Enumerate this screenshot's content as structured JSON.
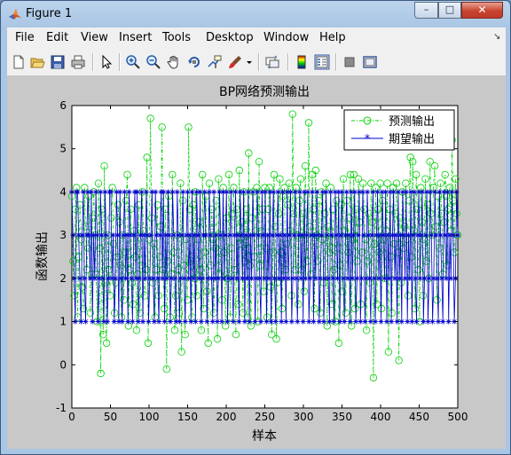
{
  "window": {
    "title": "Figure 1",
    "minimize": "–",
    "maximize": "□",
    "close": "✕"
  },
  "menubar": {
    "items": [
      "File",
      "Edit",
      "View",
      "Insert",
      "Tools",
      "Desktop",
      "Window",
      "Help"
    ],
    "overflow": "↘"
  },
  "toolbar": {
    "buttons": [
      "new-figure",
      "open-file",
      "save-figure",
      "print-figure",
      "edit-plot",
      "zoom-in",
      "zoom-out",
      "pan",
      "rotate-3d",
      "data-cursor",
      "brush",
      "brush-dropdown",
      "link-plot",
      "insert-colorbar",
      "insert-legend",
      "hide-plot-tools",
      "show-plot-tools"
    ]
  },
  "chart_data": {
    "type": "line",
    "title": "BP网络预测输出",
    "xlabel": "样本",
    "ylabel": "函数输出",
    "xlim": [
      0,
      500
    ],
    "ylim": [
      -1,
      6
    ],
    "xticks": [
      "0",
      "50",
      "100",
      "150",
      "200",
      "250",
      "300",
      "350",
      "400",
      "450",
      "500"
    ],
    "yticks": [
      "-1",
      "0",
      "1",
      "2",
      "3",
      "4",
      "5",
      "6"
    ],
    "grid": false,
    "legend_position": "top-right",
    "series": [
      {
        "name": "预测输出",
        "color": "#00d000",
        "marker": "o",
        "linestyle": "dash-dot",
        "values": [
          3.9,
          2.4,
          1.6,
          3.6,
          4.1,
          1.1,
          2.5,
          3.7,
          2.9,
          1.8,
          1.3,
          4.1,
          3.2,
          2.2,
          2.7,
          3.9,
          1.2,
          2.1,
          3.4,
          4.0,
          3.0,
          2.1,
          1.0,
          4.2,
          2.7,
          -0.2,
          3.6,
          0.7,
          4.6,
          1.9,
          0.5,
          3.0,
          2.2,
          1.6,
          3.4,
          4.1,
          2.8,
          1.2,
          1.9,
          2.5,
          3.7,
          3.3,
          2.3,
          1.1,
          3.0,
          1.5,
          2.6,
          3.8,
          4.4,
          0.9,
          2.2,
          3.6,
          1.9,
          1.4,
          3.1,
          2.5,
          0.8,
          2.1,
          3.7,
          1.2,
          2.3,
          4.0,
          3.1,
          1.6,
          2.2,
          4.8,
          0.5,
          2.9,
          5.7,
          3.4,
          1.9,
          2.8,
          1.1,
          2.2,
          3.7,
          1.6,
          2.5,
          3.2,
          5.5,
          2.2,
          1.3,
          3.6,
          -0.1,
          2.4,
          3.9,
          1.1,
          2.1,
          4.4,
          2.6,
          0.8,
          1.6,
          3.0,
          2.2,
          1.2,
          4.2,
          0.3,
          3.8,
          2.3,
          0.7,
          2.9,
          1.5,
          5.5,
          3.6,
          2.4,
          1.1,
          3.7,
          2.0,
          4.0,
          1.6,
          2.9,
          3.3,
          2.2,
          0.8,
          4.4,
          1.3,
          2.6,
          3.9,
          1.7,
          0.5,
          4.2,
          2.3,
          3.6,
          2.9,
          1.2,
          2.7,
          3.8,
          0.6,
          4.3,
          2.1,
          3.0,
          1.5,
          4.1,
          2.6,
          0.9,
          3.4,
          2.0,
          4.4,
          1.1,
          2.7,
          3.5,
          4.1,
          2.2,
          0.7,
          3.6,
          1.4,
          4.5,
          2.8,
          3.3,
          1.2,
          4.0,
          2.4,
          3.6,
          1.1,
          4.9,
          2.3,
          0.9,
          3.4,
          4.0,
          2.5,
          3.1,
          4.1,
          1.0,
          4.7,
          2.3,
          3.1,
          3.6,
          1.7,
          4.1,
          2.7,
          1.1,
          3.6,
          4.1,
          1.8,
          0.7,
          2.6,
          4.4,
          3.2,
          0.6,
          1.9,
          3.5,
          4.3,
          2.6,
          1.3,
          3.9,
          4.1,
          2.2,
          2.8,
          3.7,
          4.2,
          3.1,
          1.6,
          5.8,
          3.5,
          2.2,
          4.1,
          3.0,
          1.4,
          3.8,
          4.3,
          2.2,
          3.5,
          1.7,
          4.6,
          3.0,
          2.4,
          5.6,
          3.2,
          2.1,
          4.4,
          3.6,
          1.3,
          4.5,
          3.0,
          2.4,
          3.8,
          1.2,
          4.0,
          2.9,
          1.9,
          3.5,
          4.2,
          0.9,
          3.2,
          2.6,
          4.1,
          1.4,
          3.6,
          2.2,
          1.0,
          3.8,
          2.7,
          0.5,
          2.3,
          3.7,
          1.7,
          4.3,
          3.1,
          1.2,
          3.8,
          2.6,
          3.4,
          4.4,
          0.9,
          2.9,
          4.4,
          1.3,
          3.6,
          2.4,
          4.3,
          3.3,
          1.4,
          2.6,
          4.2,
          3.6,
          2.9,
          0.8,
          2.4,
          3.5,
          1.9,
          4.2,
          3.3,
          -0.3,
          2.8,
          4.1,
          1.4,
          3.6,
          2.6,
          4.2,
          1.3,
          3.8,
          2.9,
          2.0,
          3.1,
          4.2,
          0.3,
          3.6,
          2.5,
          1.2,
          4.1,
          2.8,
          3.5,
          4.2,
          2.6,
          0.1,
          3.4,
          1.9,
          4.0,
          2.7,
          3.2,
          4.2,
          2.9,
          1.6,
          3.8,
          4.8,
          2.5,
          4.7,
          3.1,
          1.3,
          4.4,
          3.6,
          2.2,
          1.0,
          4.1,
          3.3,
          1.6,
          2.9,
          4.3,
          2.4,
          3.7,
          2.0,
          4.7,
          3.5,
          3.0,
          4.1,
          4.6,
          3.2,
          1.5,
          3.9,
          2.7,
          4.2,
          3.5,
          2.1,
          3.3,
          4.4,
          3.9,
          2.3,
          3.6,
          4.1,
          3.1,
          5.2,
          3.8,
          2.6,
          4.3,
          3.5,
          3.0
        ]
      },
      {
        "name": "期望输出",
        "color": "#0000cc",
        "marker": "*",
        "linestyle": "solid",
        "values": [
          4,
          3,
          2,
          1,
          4,
          4,
          3,
          2,
          1,
          3,
          4,
          2,
          1,
          3,
          4,
          3,
          2,
          4,
          1,
          3,
          2,
          4,
          3,
          1,
          2,
          4,
          3,
          2,
          1,
          4,
          3,
          1,
          2,
          4,
          4,
          2,
          3,
          1,
          2,
          4,
          3,
          1,
          4,
          2,
          1,
          3,
          4,
          2,
          3,
          1,
          4,
          3,
          2,
          1,
          3,
          4,
          2,
          4,
          1,
          2,
          3,
          4,
          1,
          3,
          2,
          4,
          3,
          1,
          2,
          3,
          4,
          2,
          1,
          4,
          3,
          2,
          1,
          3,
          4,
          2,
          4,
          1,
          3,
          2,
          4,
          3,
          1,
          2,
          4,
          3,
          2,
          1,
          4,
          3,
          1,
          2,
          3,
          4,
          2,
          1,
          3,
          4,
          2,
          3,
          1,
          4,
          2,
          3,
          1,
          4,
          3,
          2,
          4,
          1,
          2,
          3,
          4,
          3,
          1,
          2,
          4,
          3,
          2,
          1,
          4,
          2,
          3,
          1,
          2,
          4,
          3,
          1,
          4,
          2,
          3,
          4,
          1,
          2,
          3,
          4,
          2,
          1,
          3,
          4,
          2,
          3,
          1,
          4,
          3,
          2,
          4,
          1,
          3,
          2,
          4,
          1,
          3,
          2,
          4,
          3,
          1,
          2,
          4,
          3,
          2,
          1,
          4,
          3,
          2,
          4,
          1,
          3,
          2,
          4,
          1,
          3,
          4,
          2,
          1,
          3,
          4,
          2,
          3,
          1,
          4,
          2,
          3,
          1,
          4,
          2,
          3,
          4,
          1,
          2,
          3,
          4,
          2,
          1,
          3,
          4,
          2,
          3,
          1,
          4,
          2,
          3,
          4,
          1,
          2,
          3,
          4,
          1,
          3,
          2,
          4,
          3,
          1,
          2,
          3,
          4,
          1,
          2,
          4,
          3,
          2,
          1,
          4,
          3,
          2,
          1,
          4,
          3,
          2,
          4,
          1,
          3,
          4,
          2,
          1,
          3,
          4,
          2,
          3,
          1,
          4,
          2,
          3,
          4,
          1,
          2,
          3,
          4,
          1,
          2,
          4,
          3,
          1,
          2,
          4,
          3,
          2,
          1,
          3,
          4,
          2,
          1,
          3,
          4,
          2,
          3,
          1,
          4,
          3,
          2,
          4,
          1,
          3,
          2,
          4,
          1,
          3,
          4,
          2,
          3,
          1,
          4,
          2,
          3,
          1,
          4,
          3,
          2,
          4,
          1,
          3,
          2,
          4,
          1,
          3,
          4,
          2,
          1,
          3,
          4,
          2,
          3,
          4,
          1,
          2,
          3,
          4,
          1,
          2,
          4,
          3,
          1,
          2,
          4,
          3,
          2,
          1,
          4,
          3,
          2,
          1,
          4,
          3,
          2,
          4,
          1,
          3,
          2,
          4,
          3,
          1,
          2,
          4,
          3
        ]
      }
    ]
  }
}
